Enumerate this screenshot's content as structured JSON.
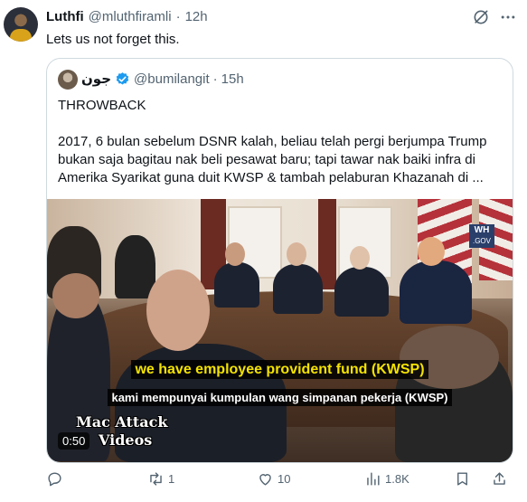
{
  "tweet": {
    "display_name": "Luthfi",
    "handle": "@mluthfiramli",
    "separator": "·",
    "time": "12h",
    "text": "Lets us not forget this."
  },
  "quote": {
    "display_name": "جون",
    "handle": "@bumilangit",
    "separator": "·",
    "time": "15h",
    "lines": [
      "THROWBACK",
      "2017, 6 bulan sebelum DSNR kalah, beliau telah pergi berjumpa Trump",
      "bukan saja bagitau nak beli pesawat baru; tapi tawar nak baiki infra di",
      "Amerika Syarikat guna duit KWSP & tambah pelaburan Khazanah di ..."
    ],
    "video": {
      "caption_english": "we have employee provident fund (KWSP)",
      "caption_malay": "kami mempunyai kumpulan wang simpanan pekerja (KWSP)",
      "watermark_line1": "Mac Attack",
      "watermark_line2": "Videos",
      "channel_line1": "WH",
      "channel_line2": ".GOV",
      "duration": "0:50"
    }
  },
  "actions": {
    "reply_count": "",
    "retweet_count": "1",
    "like_count": "10",
    "views_count": "1.8K"
  },
  "colors": {
    "text_primary": "#0f1419",
    "text_secondary": "#536471",
    "border": "#cfd9de",
    "verified": "#1d9bf0",
    "caption_yellow": "#f4e300"
  },
  "icons": [
    "grok-icon",
    "more-icon",
    "verified-icon",
    "reply-icon",
    "retweet-icon",
    "like-icon",
    "views-icon",
    "bookmark-icon",
    "share-icon"
  ]
}
